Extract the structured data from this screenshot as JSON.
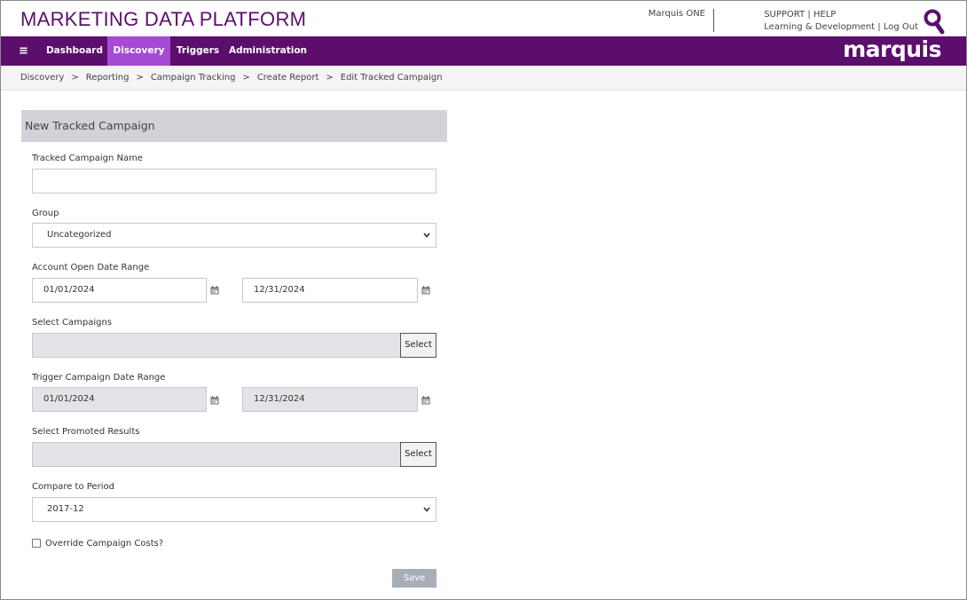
{
  "header": {
    "title": "MARKETING DATA PLATFORM",
    "product_link": "Marquis ONE",
    "support_link": "SUPPORT",
    "link_sep": "|",
    "help_link": "HELP",
    "learning_link": "Learning & Development",
    "logout_link": "Log Out",
    "brand": "marquis",
    "search_icon": "search-icon"
  },
  "nav": {
    "menu_icon": "≡",
    "items": [
      {
        "label": "Dashboard"
      },
      {
        "label": "Discovery",
        "active": true
      },
      {
        "label": "Triggers"
      },
      {
        "label": "Administration"
      }
    ],
    "color": "#5b0e6b",
    "active_color": "#a64bd4"
  },
  "breadcrumb": {
    "separator": ">",
    "items": [
      "Discovery",
      "Reporting",
      "Campaign Tracking",
      "Create Report",
      "Edit Tracked Campaign"
    ]
  },
  "form": {
    "heading": "New Tracked Campaign",
    "campaign_name": {
      "label": "Tracked Campaign Name",
      "value": ""
    },
    "group": {
      "label": "Group",
      "value": "Uncategorized"
    },
    "account_open": {
      "label": "Account Open Date Range",
      "start": "01/01/2024",
      "end": "12/31/2024"
    },
    "select_campaigns": {
      "label": "Select Campaigns",
      "value": "",
      "button": "Select"
    },
    "trigger_range": {
      "label": "Trigger Campaign Date Range",
      "start": "01/01/2024",
      "end": "12/31/2024"
    },
    "promoted_results": {
      "label": "Select Promoted Results",
      "value": "",
      "button": "Select"
    },
    "compare_period": {
      "label": "Compare to Period",
      "value": "2017-12"
    },
    "override_costs": {
      "label": "Override Campaign Costs?",
      "checked": false
    },
    "save_button": "Save"
  }
}
